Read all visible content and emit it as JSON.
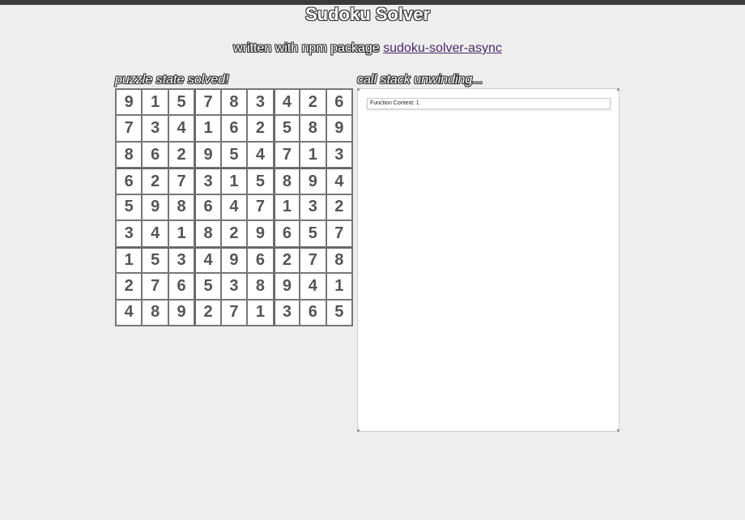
{
  "header": {
    "title": "Sudoku Solver",
    "subtitle_prefix": "written with npm package",
    "package_link": "sudoku-solver-async"
  },
  "puzzle": {
    "label_prefix": "puzzle state",
    "state": "solved!",
    "grid": [
      [
        9,
        1,
        5,
        7,
        8,
        3,
        4,
        2,
        6
      ],
      [
        7,
        3,
        4,
        1,
        6,
        2,
        5,
        8,
        9
      ],
      [
        8,
        6,
        2,
        9,
        5,
        4,
        7,
        1,
        3
      ],
      [
        6,
        2,
        7,
        3,
        1,
        5,
        8,
        9,
        4
      ],
      [
        5,
        9,
        8,
        6,
        4,
        7,
        1,
        3,
        2
      ],
      [
        3,
        4,
        1,
        8,
        2,
        9,
        6,
        5,
        7
      ],
      [
        1,
        5,
        3,
        4,
        9,
        6,
        2,
        7,
        8
      ],
      [
        2,
        7,
        6,
        5,
        3,
        8,
        9,
        4,
        1
      ],
      [
        4,
        8,
        9,
        2,
        7,
        1,
        3,
        6,
        5
      ]
    ]
  },
  "call_stack": {
    "label_prefix": "call stack",
    "status": "unwinding...",
    "frames": [
      "Function Context: 1"
    ]
  },
  "colors": {
    "background": "#eeeeee",
    "link": "#4b2a6b",
    "digit": "#555555"
  }
}
